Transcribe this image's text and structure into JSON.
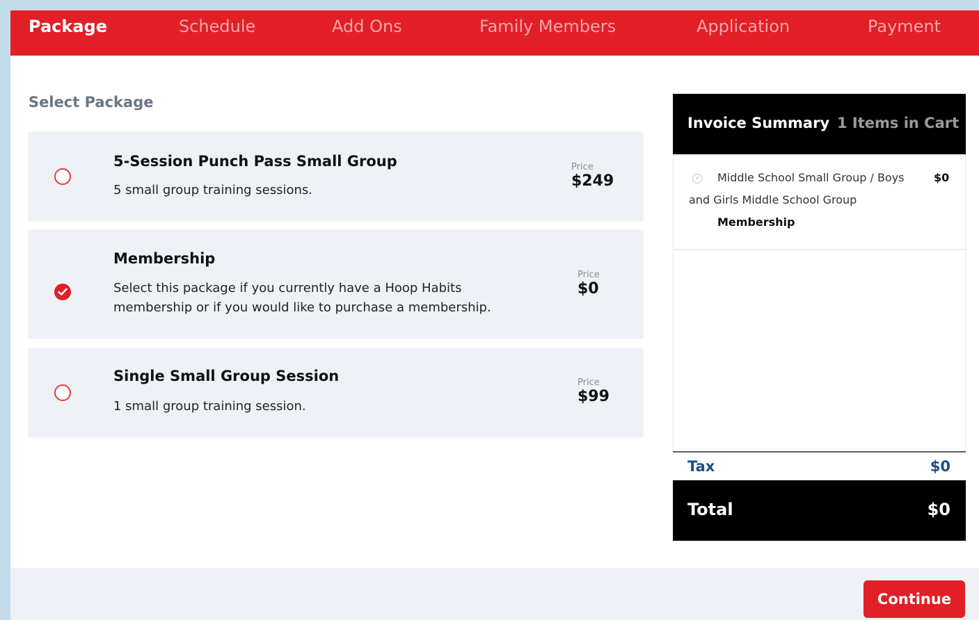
{
  "nav": {
    "tabs": [
      {
        "label": "Package",
        "active": true
      },
      {
        "label": "Schedule",
        "active": false
      },
      {
        "label": "Add Ons",
        "active": false
      },
      {
        "label": "Family Members",
        "active": false
      },
      {
        "label": "Application",
        "active": false
      },
      {
        "label": "Payment",
        "active": false
      }
    ]
  },
  "main": {
    "section_title": "Select Package",
    "packages": [
      {
        "name": "5-Session Punch Pass Small Group",
        "description": "5 small group training sessions.",
        "price_label": "Price",
        "price": "$249",
        "selected": false
      },
      {
        "name": "Membership",
        "description": "Select this package if you currently have a Hoop Habits membership or if you would like to purchase a membership.",
        "price_label": "Price",
        "price": "$0",
        "selected": true
      },
      {
        "name": "Single Small Group Session",
        "description": "1 small group training session.",
        "price_label": "Price",
        "price": "$99",
        "selected": false
      }
    ]
  },
  "invoice": {
    "title": "Invoice Summary",
    "items_count": "1 Items in Cart",
    "item": {
      "line1": "Middle School Small Group / Boys",
      "line2": "and Girls Middle School Group",
      "line3": "Membership",
      "price": "$0",
      "remove_icon": "close-circle-icon"
    },
    "tax_label": "Tax",
    "tax_value": "$0",
    "total_label": "Total",
    "total_value": "$0"
  },
  "footer": {
    "continue_label": "Continue"
  },
  "colors": {
    "brand_red": "#e21f26",
    "card_bg": "#eef2f6",
    "tax_blue": "#1e4f8a"
  }
}
